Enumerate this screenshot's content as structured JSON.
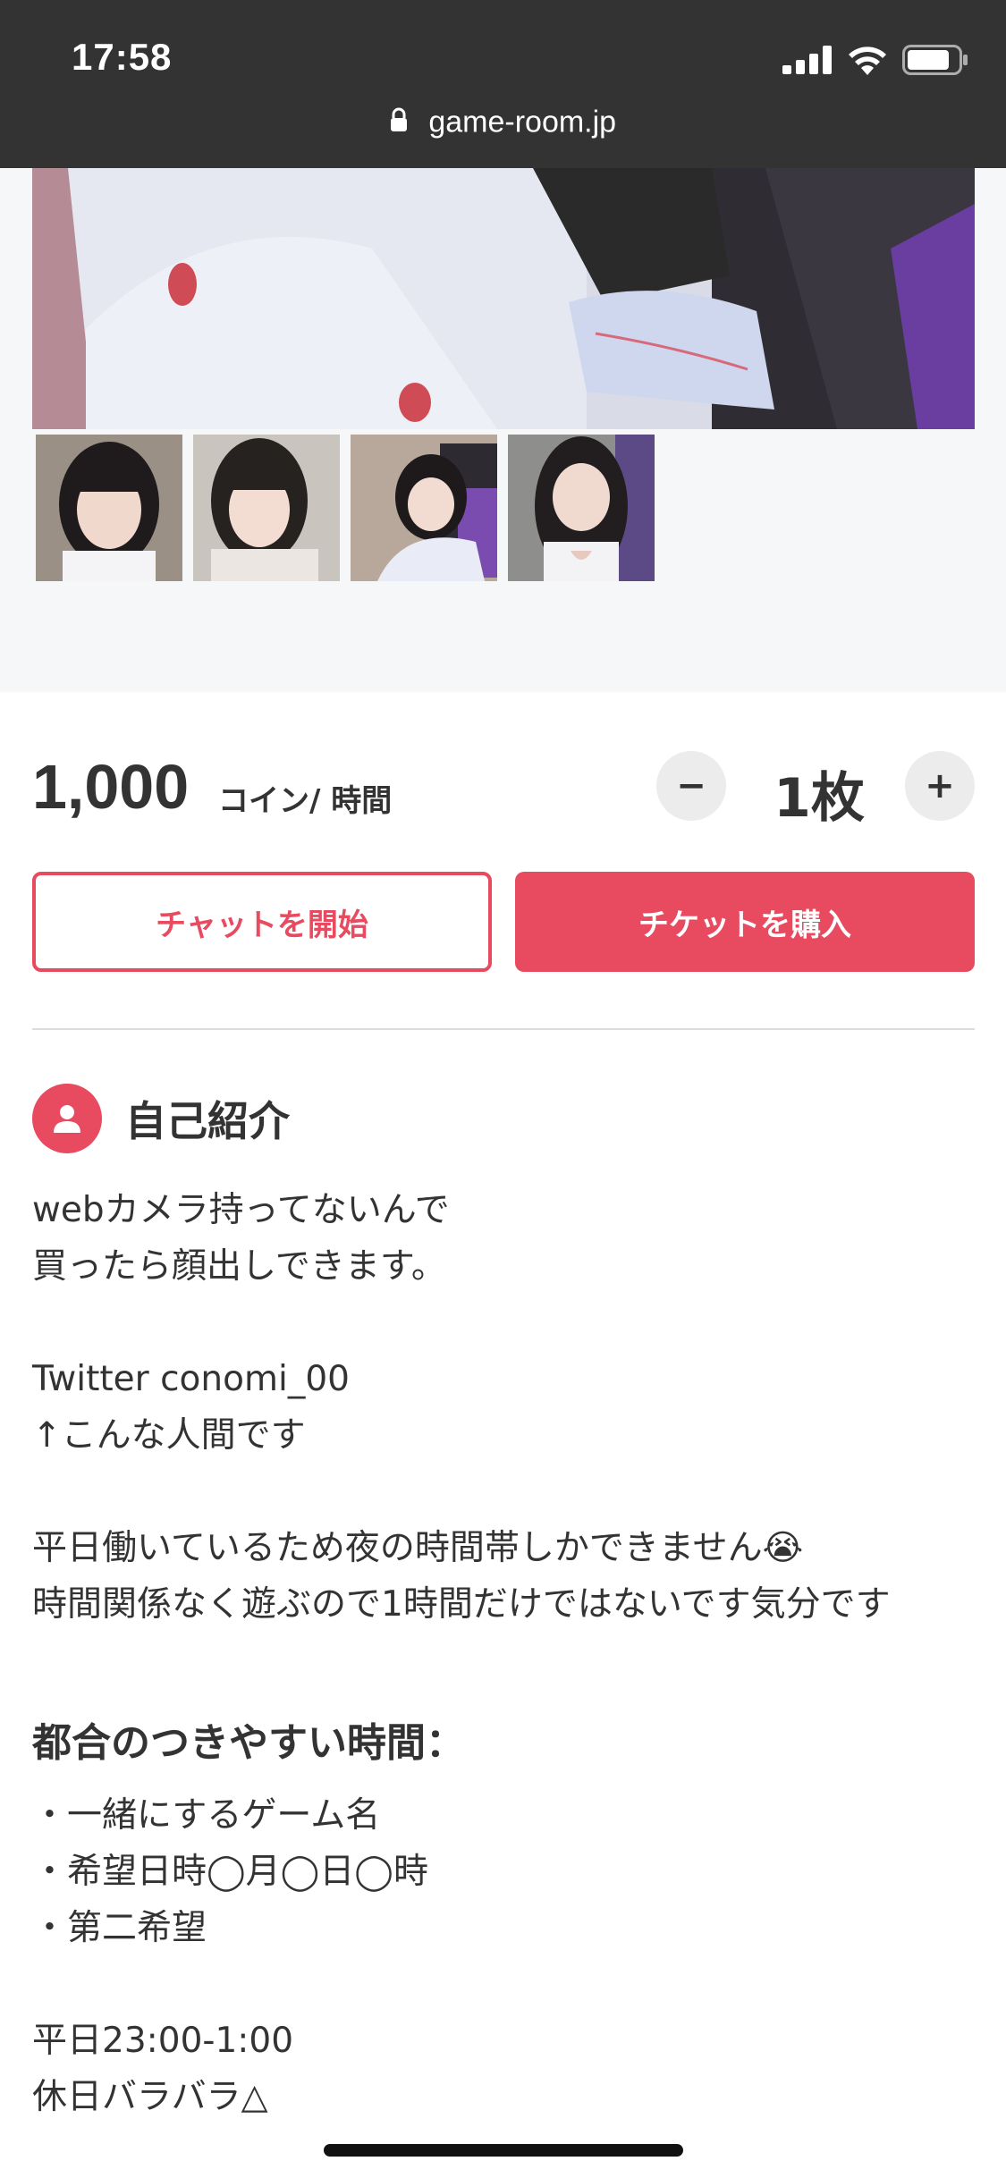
{
  "status_bar": {
    "time": "17:58",
    "url": "game-room.jp",
    "icons": [
      "signal-icon",
      "wifi-icon",
      "battery-icon",
      "lock-icon"
    ]
  },
  "gallery": {
    "thumbnail_count": 4
  },
  "pricing": {
    "price": "1,000",
    "unit": "コイン/ 時間",
    "quantity": "1枚",
    "minus_label": "−",
    "plus_label": "+"
  },
  "actions": {
    "chat_label": "チャットを開始",
    "buy_label": "チケットを購入"
  },
  "profile": {
    "section_title": "自己紹介",
    "bio_lines": [
      "webカメラ持ってないんで",
      "買ったら顔出しできます。",
      "",
      "Twitter conomi_00",
      "↑こんな人間です",
      "",
      "平日働いているため夜の時間帯しかできません😭",
      "時間関係なく遊ぶので1時間だけではないです気分です"
    ],
    "schedule_heading": "都合のつきやすい時間：",
    "schedule_lines": [
      "・一緒にするゲーム名",
      "・希望日時◯月◯日◯時",
      "・第二希望",
      "",
      "平日23:00-1:00",
      "休日バラバラ△"
    ]
  },
  "colors": {
    "accent": "#e84a5f",
    "status_bar_bg": "#333333",
    "text": "#333333",
    "gallery_bg": "#f6f7f9"
  }
}
